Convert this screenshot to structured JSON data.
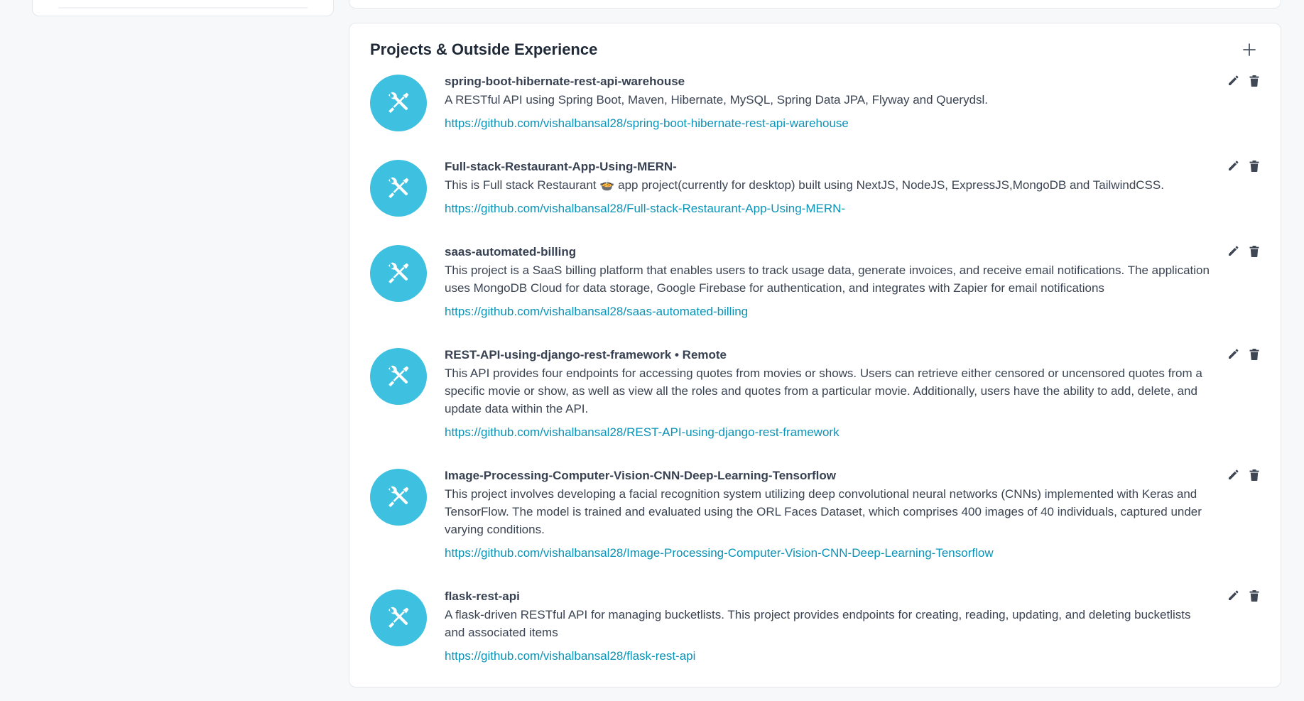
{
  "section": {
    "title": "Projects & Outside Experience"
  },
  "projects": [
    {
      "title": "spring-boot-hibernate-rest-api-warehouse",
      "remote": "",
      "description": "A RESTful API using Spring Boot, Maven, Hibernate, MySQL, Spring Data JPA, Flyway and Querydsl.",
      "link": "https://github.com/vishalbansal28/spring-boot-hibernate-rest-api-warehouse"
    },
    {
      "title": "Full-stack-Restaurant-App-Using-MERN-",
      "remote": "",
      "description": "This is Full stack Restaurant 🍲 app project(currently for desktop) built using NextJS, NodeJS, ExpressJS,MongoDB and TailwindCSS.",
      "link": "https://github.com/vishalbansal28/Full-stack-Restaurant-App-Using-MERN-"
    },
    {
      "title": "saas-automated-billing",
      "remote": "",
      "description": "This project is a SaaS billing platform that enables users to track usage data, generate invoices, and receive email notifications. The application uses MongoDB Cloud for data storage, Google Firebase for authentication, and integrates with Zapier for email notifications",
      "link": "https://github.com/vishalbansal28/saas-automated-billing"
    },
    {
      "title": "REST-API-using-django-rest-framework",
      "remote": " • Remote",
      "description": "This API provides four endpoints for accessing quotes from movies or shows. Users can retrieve either censored or uncensored quotes from a specific movie or show, as well as view all the roles and quotes from a particular movie. Additionally, users have the ability to add, delete, and update data within the API.",
      "link": "https://github.com/vishalbansal28/REST-API-using-django-rest-framework"
    },
    {
      "title": "Image-Processing-Computer-Vision-CNN-Deep-Learning-Tensorflow",
      "remote": "",
      "description": "This project involves developing a facial recognition system utilizing deep convolutional neural networks (CNNs) implemented with Keras and TensorFlow. The model is trained and evaluated using the ORL Faces Dataset, which comprises 400 images of 40 individuals, captured under varying conditions.",
      "link": "https://github.com/vishalbansal28/Image-Processing-Computer-Vision-CNN-Deep-Learning-Tensorflow"
    },
    {
      "title": "flask-rest-api",
      "remote": "",
      "description": "A flask-driven RESTful API for managing bucketlists. This project provides endpoints for creating, reading, updating, and deleting bucketlists and associated items",
      "link": "https://github.com/vishalbansal28/flask-rest-api"
    }
  ],
  "icons": {
    "project_avatar": "tools-icon",
    "edit": "pencil-icon",
    "delete": "trash-icon",
    "add": "plus-icon"
  },
  "colors": {
    "avatar": "#3ec1e0",
    "link": "#0b93b8",
    "icon": "#3f4754"
  }
}
